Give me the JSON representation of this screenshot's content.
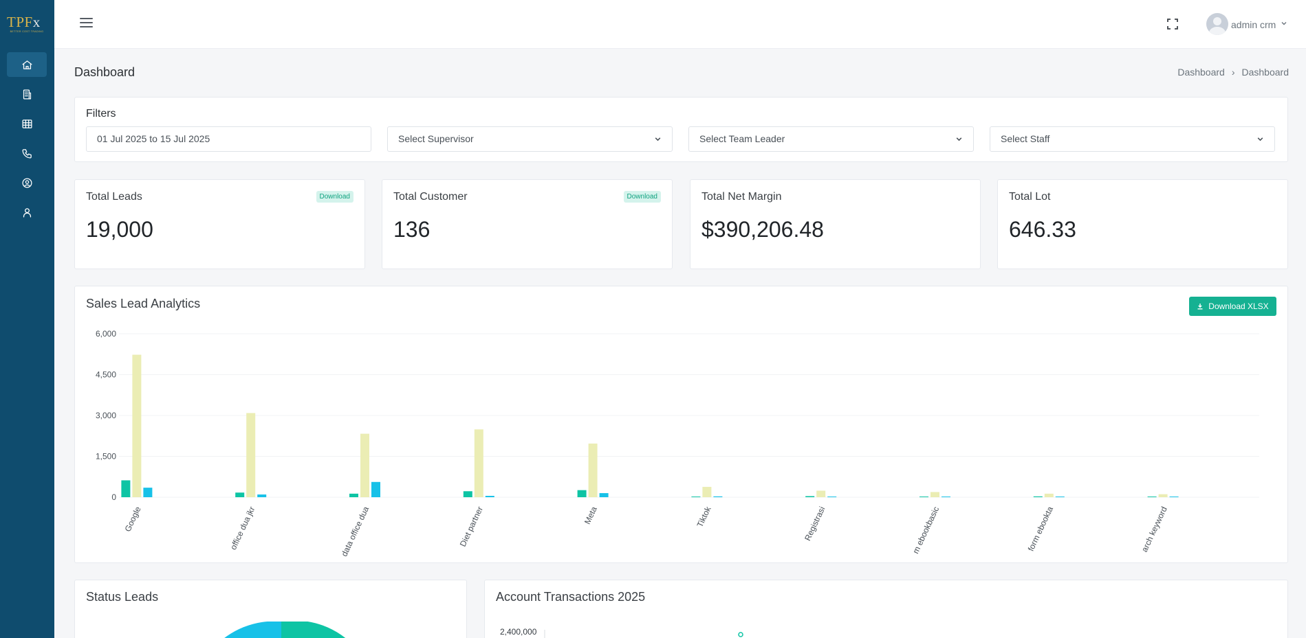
{
  "brand": {
    "logo_text": "TPFx",
    "logo_tagline": "BETTER COST TRADING"
  },
  "sidebar": {
    "items": [
      {
        "icon": "home-icon",
        "active": true
      },
      {
        "icon": "building-icon",
        "active": false
      },
      {
        "icon": "grid-icon",
        "active": false
      },
      {
        "icon": "phone-icon",
        "active": false
      },
      {
        "icon": "user-circle-icon",
        "active": false
      },
      {
        "icon": "user-icon",
        "active": false
      }
    ]
  },
  "topbar": {
    "user_name": "admin crm"
  },
  "page": {
    "title": "Dashboard",
    "breadcrumb": [
      "Dashboard",
      "Dashboard"
    ]
  },
  "filters": {
    "label": "Filters",
    "date_range": "01 Jul 2025 to 15 Jul 2025",
    "supervisor_placeholder": "Select Supervisor",
    "team_leader_placeholder": "Select Team Leader",
    "staff_placeholder": "Select Staff"
  },
  "stats": [
    {
      "title": "Total Leads",
      "value": "19,000",
      "badge": "Download"
    },
    {
      "title": "Total Customer",
      "value": "136",
      "badge": "Download"
    },
    {
      "title": "Total Net Margin",
      "value": "$390,206.48",
      "badge": ""
    },
    {
      "title": "Total Lot",
      "value": "646.33",
      "badge": ""
    }
  ],
  "analytics": {
    "title": "Sales Lead Analytics",
    "download_label": "Download XLSX"
  },
  "status_leads": {
    "title": "Status Leads"
  },
  "account_transactions": {
    "title": "Account Transactions 2025",
    "top_tick": "2,400,000"
  },
  "colors": {
    "sidebar": "#0f4c6e",
    "accent": "#15b192",
    "series1": "#0ec4a4",
    "series2": "#ebedb4",
    "series3": "#17c1e8"
  },
  "chart_data": {
    "type": "bar",
    "categories": [
      "Google",
      "office dua jkr",
      "data office dua",
      "Diet partner",
      "Meta",
      "Tiktok",
      "Registrasi",
      "m ebookbasic",
      "form ebookta",
      "arch keyword"
    ],
    "series": [
      {
        "values": [
          620,
          170,
          130,
          220,
          260,
          10,
          40,
          20,
          30,
          10
        ]
      },
      {
        "values": [
          5230,
          3090,
          2330,
          2490,
          1970,
          380,
          240,
          190,
          130,
          110
        ]
      },
      {
        "values": [
          350,
          100,
          560,
          50,
          150,
          30,
          10,
          10,
          10,
          5
        ]
      }
    ],
    "yticks": [
      "0",
      "1,500",
      "3,000",
      "4,500",
      "6,000"
    ],
    "ylim": [
      0,
      6000
    ],
    "grid": true
  }
}
